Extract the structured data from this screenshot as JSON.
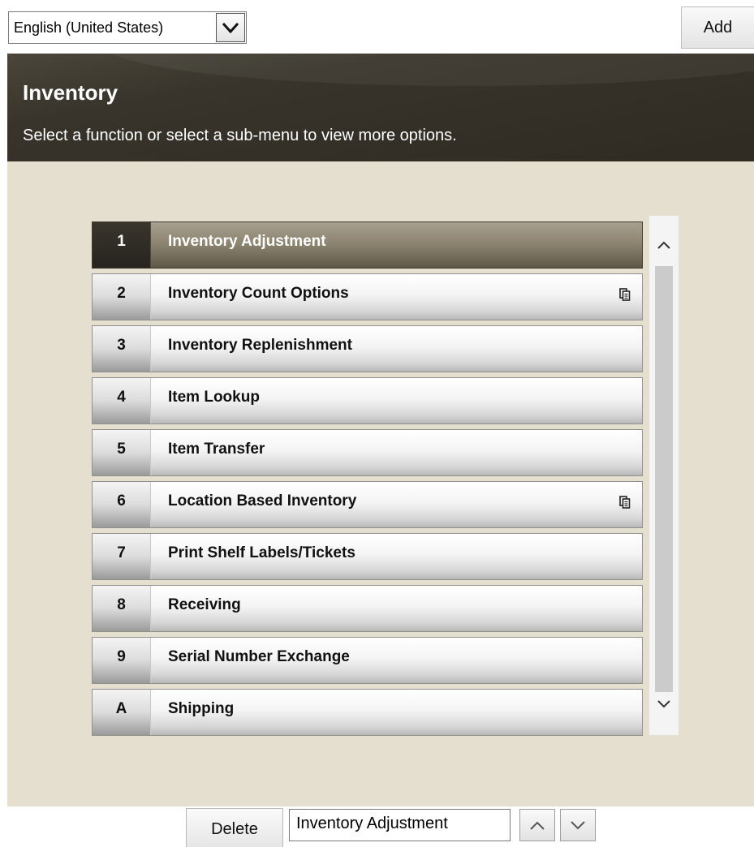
{
  "language_select": {
    "value": "English (United States)",
    "dropdown_icon": "chevron-down-icon"
  },
  "add_button": {
    "label": "Add"
  },
  "panel": {
    "title": "Inventory",
    "subtitle": "Select a function or select a sub-menu to view more options."
  },
  "menu": {
    "items": [
      {
        "key": "1",
        "label": "Inventory Adjustment",
        "selected": true,
        "has_submenu": false
      },
      {
        "key": "2",
        "label": "Inventory Count Options",
        "selected": false,
        "has_submenu": true
      },
      {
        "key": "3",
        "label": "Inventory Replenishment",
        "selected": false,
        "has_submenu": false
      },
      {
        "key": "4",
        "label": "Item Lookup",
        "selected": false,
        "has_submenu": false
      },
      {
        "key": "5",
        "label": "Item Transfer",
        "selected": false,
        "has_submenu": false
      },
      {
        "key": "6",
        "label": "Location Based Inventory",
        "selected": false,
        "has_submenu": true
      },
      {
        "key": "7",
        "label": "Print Shelf Labels/Tickets",
        "selected": false,
        "has_submenu": false
      },
      {
        "key": "8",
        "label": "Receiving",
        "selected": false,
        "has_submenu": false
      },
      {
        "key": "9",
        "label": "Serial Number Exchange",
        "selected": false,
        "has_submenu": false
      },
      {
        "key": "A",
        "label": "Shipping",
        "selected": false,
        "has_submenu": false
      }
    ],
    "submenu_icon": "submenu-pages-icon"
  },
  "scrollbar": {
    "up_icon": "chevron-up-icon",
    "down_icon": "chevron-down-icon"
  },
  "bottom_bar": {
    "delete_label": "Delete",
    "name_value": "Inventory Adjustment",
    "move_up_icon": "chevron-up-icon",
    "move_down_icon": "chevron-down-icon"
  },
  "colors": {
    "header_bg": "#38342b",
    "panel_bg": "#e5dfd0",
    "selected_row": "#8a826e"
  }
}
